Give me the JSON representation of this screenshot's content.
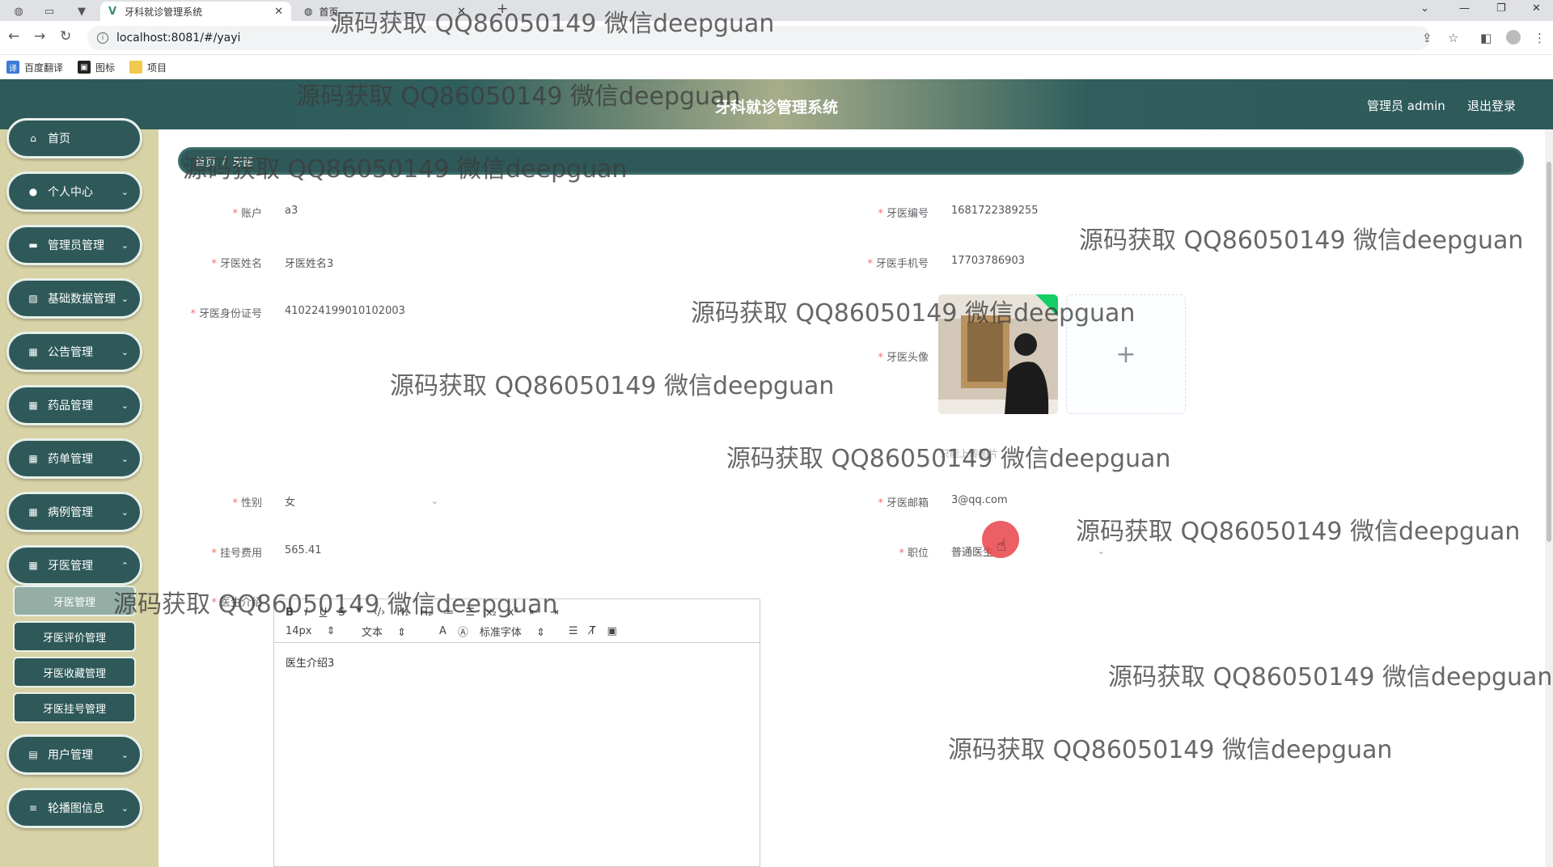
{
  "browser": {
    "active_tab_title": "牙科就诊管理系统",
    "second_tab_title": "首页",
    "url": "localhost:8081/#/yayi",
    "bookmarks": [
      "百度翻译",
      "图标",
      "项目"
    ]
  },
  "header": {
    "title": "牙科就诊管理系统",
    "user": "管理员 admin",
    "logout": "退出登录"
  },
  "sidebar": {
    "items": [
      {
        "label": "首页",
        "icon": "home-icon"
      },
      {
        "label": "个人中心",
        "icon": "user-icon"
      },
      {
        "label": "管理员管理",
        "icon": "monitor-icon"
      },
      {
        "label": "基础数据管理",
        "icon": "chart-icon"
      },
      {
        "label": "公告管理",
        "icon": "grid-icon"
      },
      {
        "label": "药品管理",
        "icon": "grid-icon"
      },
      {
        "label": "药单管理",
        "icon": "grid-icon"
      },
      {
        "label": "病例管理",
        "icon": "grid-icon"
      },
      {
        "label": "牙医管理",
        "icon": "grid-icon"
      }
    ],
    "sub_items": [
      "牙医管理",
      "牙医评价管理",
      "牙医收藏管理",
      "牙医挂号管理"
    ],
    "bottom_items": [
      {
        "label": "用户管理",
        "icon": "doc-icon"
      },
      {
        "label": "轮播图信息",
        "icon": "list-icon"
      }
    ]
  },
  "breadcrumb": {
    "home": "首页",
    "sep": "/",
    "current": "牙医"
  },
  "form": {
    "account_label": "账户",
    "account_value": "a3",
    "dentist_no_label": "牙医编号",
    "dentist_no_value": "1681722389255",
    "name_label": "牙医姓名",
    "name_value": "牙医姓名3",
    "phone_label": "牙医手机号",
    "phone_value": "17703786903",
    "idcard_label": "牙医身份证号",
    "idcard_value": "410224199010102003",
    "avatar_label": "牙医头像",
    "upload_plus": "+",
    "hint_text": "只能上传图片",
    "gender_label": "性别",
    "gender_value": "女",
    "email_label": "牙医邮箱",
    "email_value": "3@qq.com",
    "fee_label": "挂号费用",
    "fee_value": "565.41",
    "position_label": "职位",
    "position_value": "普通医生",
    "intro_label": "医生介绍",
    "intro_value": "医生介绍3"
  },
  "editor_toolbar": {
    "row1": [
      "B",
      "I",
      "U",
      "S",
      "❞",
      "‹/›",
      "H₁",
      "H₂",
      "≔",
      "☰",
      "x₂",
      "x²",
      "⇤",
      "⇥"
    ],
    "size": "14px",
    "paragraph": "文本",
    "font": "标准字体"
  },
  "watermark": "源码获取 QQ86050149 微信deepguan"
}
